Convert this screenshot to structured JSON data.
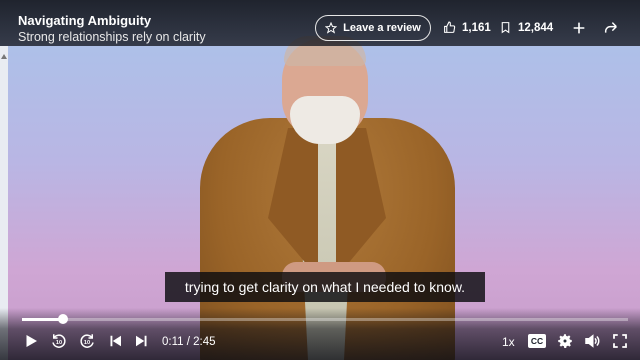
{
  "course": {
    "title": "Navigating Ambiguity",
    "subtitle": "Strong relationships rely on clarity"
  },
  "actions": {
    "review_label": "Leave a review",
    "likes": "1,161",
    "saves": "12,844"
  },
  "caption": {
    "text": "trying to get clarity on what I needed to know."
  },
  "player": {
    "time": "0:11 / 2:45",
    "speed": "1x",
    "cc_label": "CC",
    "progress": 0.067,
    "rewind_seconds": "10",
    "forward_seconds": "10"
  }
}
